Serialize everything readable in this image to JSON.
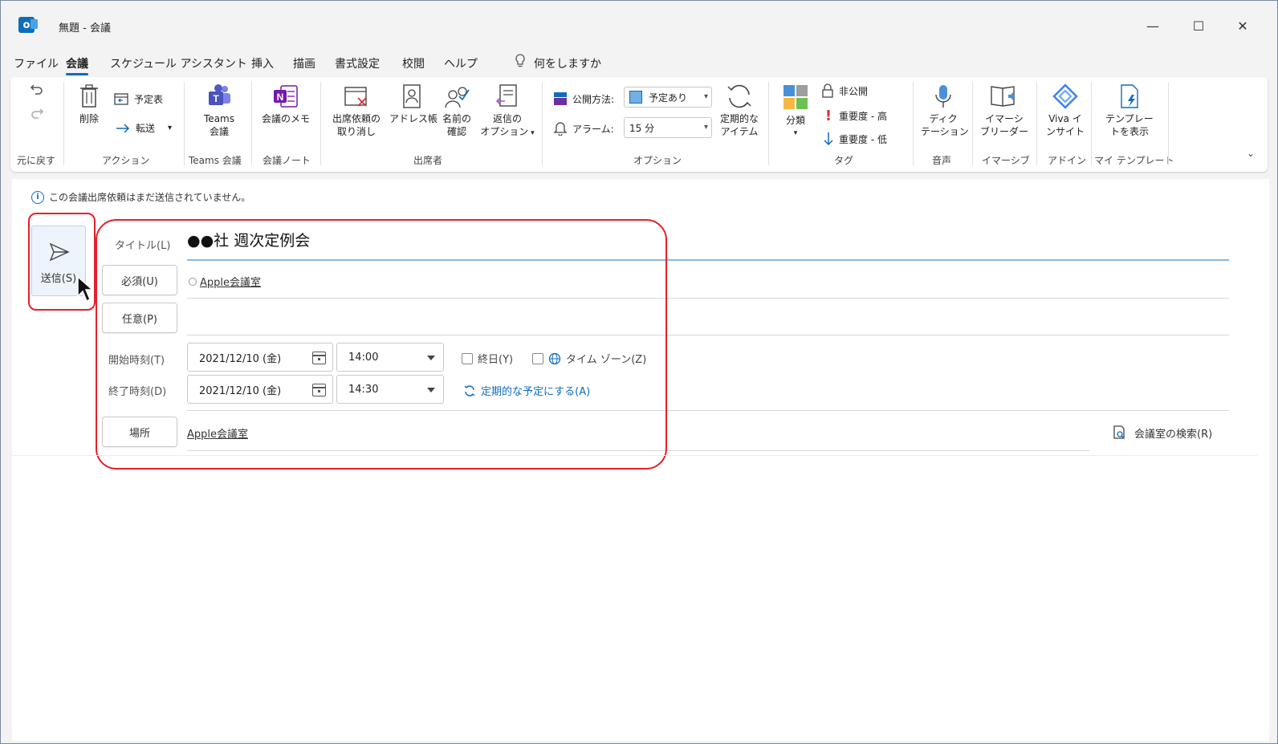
{
  "window": {
    "title": "無題 - 会議",
    "controls": {
      "minimize": "—",
      "maximize": "☐",
      "close": "✕"
    }
  },
  "menu": {
    "tabs": [
      "ファイル",
      "会議",
      "スケジュール アシスタント",
      "挿入",
      "描画",
      "書式設定",
      "校閲",
      "ヘルプ"
    ],
    "active_tab": "会議",
    "tell_me": "何をしますか"
  },
  "ribbon": {
    "undo_group": {
      "label": "元に戻す"
    },
    "actions": {
      "label": "アクション",
      "delete": "削除",
      "calendar": "予定表",
      "forward": "転送"
    },
    "teams": {
      "label": "Teams 会議",
      "button_line1": "Teams",
      "button_line2": "会議"
    },
    "notes": {
      "label": "会議ノート",
      "button": "会議のメモ"
    },
    "attendees": {
      "label": "出席者",
      "cancel_line1": "出席依頼の",
      "cancel_line2": "取り消し",
      "address_book": "アドレス帳",
      "check_names_line1": "名前の",
      "check_names_line2": "確認",
      "response_line1": "返信の",
      "response_line2": "オプション"
    },
    "options": {
      "label": "オプション",
      "show_as_label": "公開方法:",
      "show_as_value": "予定あり",
      "reminder_label": "アラーム:",
      "reminder_value": "15 分",
      "recurrence_line1": "定期的な",
      "recurrence_line2": "アイテム"
    },
    "tags": {
      "label": "タグ",
      "categorize": "分類",
      "private": "非公開",
      "high": "重要度 - 高",
      "low": "重要度 - 低"
    },
    "voice": {
      "label": "音声",
      "line1": "ディク",
      "line2": "テーション"
    },
    "immersive": {
      "label": "イマーシブ",
      "line1": "イマーシ",
      "line2": "ブリーダー"
    },
    "addins": {
      "label": "アドイン",
      "line1": "Viva イ",
      "line2": "ンサイト"
    },
    "templates": {
      "label": "マイ テンプレート",
      "line1": "テンプレー",
      "line2": "トを表示"
    }
  },
  "form": {
    "info": "この会議出席依頼はまだ送信されていません。",
    "send": "送信(S)",
    "title_label": "タイトル(L)",
    "title_value": "●●社 週次定例会",
    "required_button": "必須(U)",
    "required_value": "Apple会議室",
    "optional_button": "任意(P)",
    "start_label": "開始時刻(T)",
    "start_date": "2021/12/10 (金)",
    "start_time": "14:00",
    "end_label": "終了時刻(D)",
    "end_date": "2021/12/10 (金)",
    "end_time": "14:30",
    "all_day": "終日(Y)",
    "time_zone": "タイム ゾーン(Z)",
    "recurring": "定期的な予定にする(A)",
    "location_button": "場所",
    "location_value": "Apple会議室",
    "room_finder": "会議室の検索(R)"
  },
  "colors": {
    "accent": "#0f6cbd",
    "highlight": "#e4202a"
  }
}
